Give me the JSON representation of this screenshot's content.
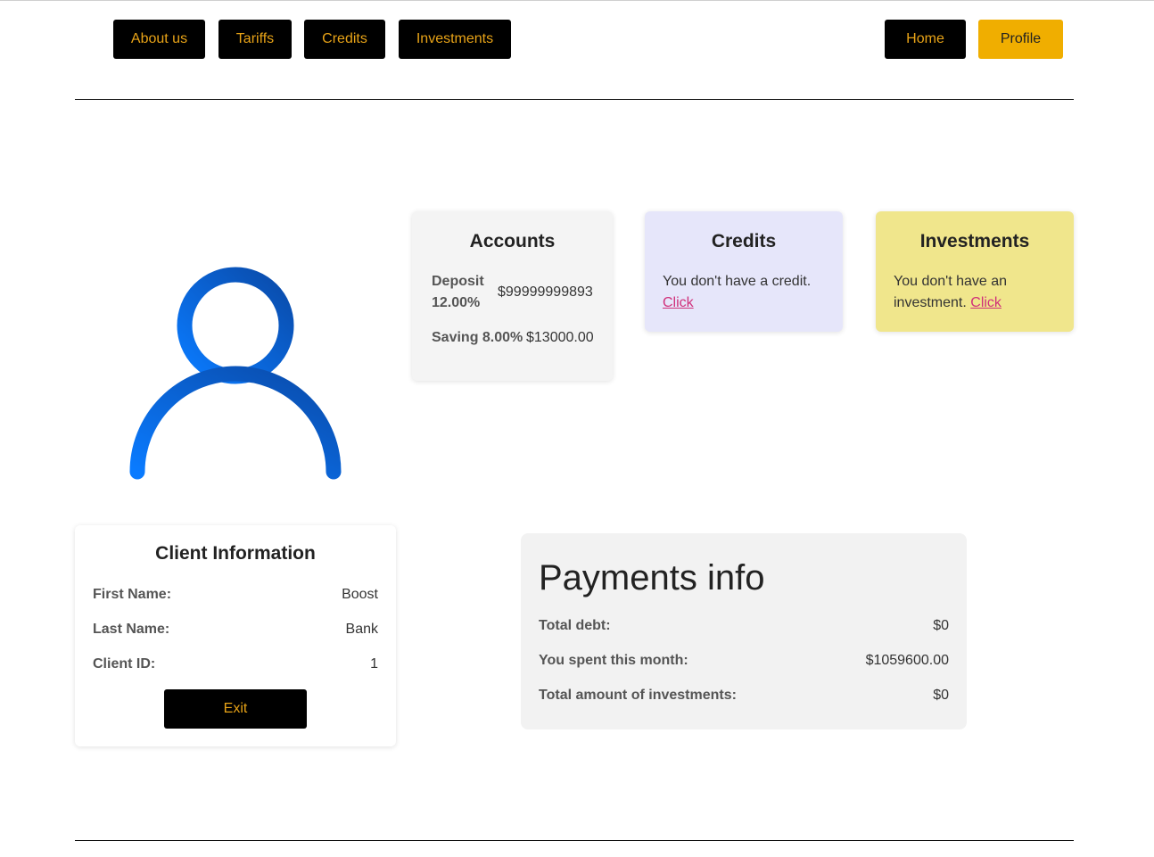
{
  "nav": {
    "about": "About us",
    "tariffs": "Tariffs",
    "credits": "Credits",
    "investments": "Investments",
    "home": "Home",
    "profile": "Profile"
  },
  "accounts": {
    "title": "Accounts",
    "deposit_label": "Deposit 12.00%",
    "deposit_value": "$99999999893",
    "saving_label": "Saving 8.00%",
    "saving_value": "$13000.00"
  },
  "credits": {
    "title": "Credits",
    "text": "You don't have a credit.",
    "link": "Click"
  },
  "investments": {
    "title": "Investments",
    "text": "You don't have an investment.",
    "link": "Click"
  },
  "client": {
    "title": "Client Information",
    "first_name_label": "First Name:",
    "first_name": "Boost",
    "last_name_label": "Last Name:",
    "last_name": "Bank",
    "client_id_label": "Client ID:",
    "client_id": "1",
    "exit": "Exit"
  },
  "payments": {
    "title": "Payments info",
    "debt_label": "Total debt:",
    "debt": "$0",
    "spent_label": "You spent this month:",
    "spent": "$1059600.00",
    "inv_label": "Total amount of investments:",
    "inv": "$0"
  },
  "colors": {
    "nav_bg": "#000000",
    "nav_text": "#e8a317",
    "profile_bg": "#f0ae00",
    "accounts_bg": "#f4f4f4",
    "credits_bg": "#e6e6fa",
    "investments_bg": "#f0e68c",
    "payments_bg": "#f2f2f2",
    "avatar_icon": "#0066dd"
  }
}
